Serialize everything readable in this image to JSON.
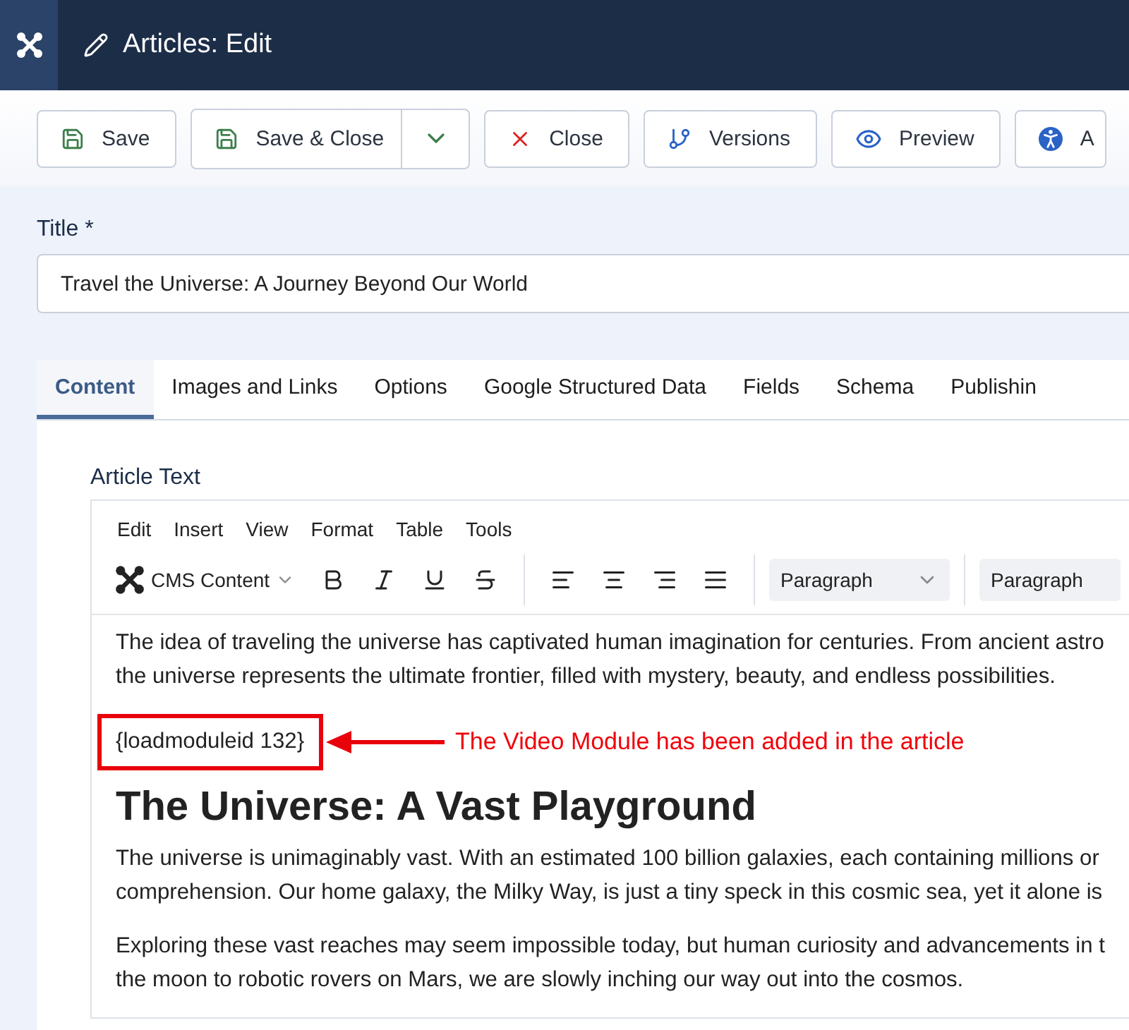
{
  "header": {
    "title": "Articles: Edit"
  },
  "toolbar": [
    {
      "kind": "save",
      "label": "Save"
    },
    {
      "kind": "split",
      "label": "Save & Close"
    },
    {
      "kind": "close",
      "label": "Close"
    },
    {
      "kind": "versions",
      "label": "Versions"
    },
    {
      "kind": "preview",
      "label": "Preview"
    },
    {
      "kind": "accessibility",
      "label": "A"
    }
  ],
  "title_field": {
    "label": "Title *",
    "value": "Travel the Universe: A Journey Beyond Our World"
  },
  "tabs": [
    {
      "label": "Content",
      "selected": true
    },
    {
      "label": "Images and Links",
      "selected": false
    },
    {
      "label": "Options",
      "selected": false
    },
    {
      "label": "Google Structured Data",
      "selected": false
    },
    {
      "label": "Fields",
      "selected": false
    },
    {
      "label": "Schema",
      "selected": false
    },
    {
      "label": "Publishin",
      "selected": false
    }
  ],
  "editor": {
    "label": "Article Text",
    "menu": [
      "Edit",
      "Insert",
      "View",
      "Format",
      "Table",
      "Tools"
    ],
    "cms_content": "CMS Content",
    "selects": [
      "Paragraph",
      "Paragraph"
    ],
    "blocks": [
      {
        "kind": "p",
        "lines": [
          "The idea of traveling the universe has captivated human imagination for centuries. From ancient astro",
          "the universe represents the ultimate frontier, filled with mystery, beauty, and endless possibilities."
        ]
      },
      {
        "kind": "code",
        "text": "{loadmoduleid 132}",
        "note": "The Video Module has been added in the article"
      },
      {
        "kind": "h",
        "text": "The Universe: A Vast Playground"
      },
      {
        "kind": "p",
        "lines": [
          "The universe is unimaginably vast. With an estimated 100 billion galaxies, each containing millions or",
          "comprehension. Our home galaxy, the Milky Way, is just a tiny speck in this cosmic sea, yet it alone is"
        ]
      },
      {
        "kind": "p",
        "lines": [
          "Exploring these vast reaches may seem impossible today, but human curiosity and advancements in t",
          "the moon to robotic rovers on Mars, we are slowly inching our way out into the cosmos."
        ]
      }
    ]
  }
}
